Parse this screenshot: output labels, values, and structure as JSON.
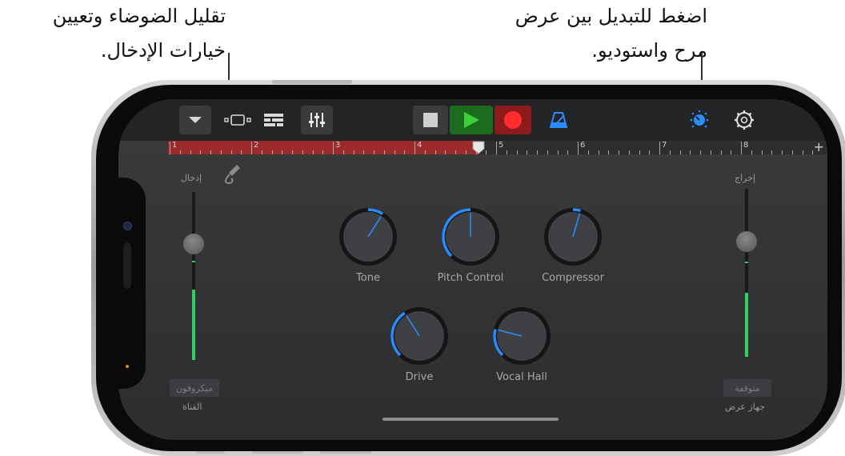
{
  "callouts": {
    "right": {
      "line1": "اضغط للتبديل بين عرض",
      "line2": "مرح واستوديو."
    },
    "left": {
      "line1": "تقليل الضوضاء وتعيين",
      "line2": "خيارات الإدخال."
    }
  },
  "ruler": {
    "bars": [
      "1",
      "2",
      "3",
      "4",
      "5",
      "6",
      "7",
      "8"
    ],
    "add_label": "+"
  },
  "input": {
    "label": "إدخال",
    "channel_button": "ميكروفون",
    "channel_label": "القناة",
    "level": 0.42
  },
  "output": {
    "label": "إخراج",
    "device_button": "متوقفة",
    "device_label": "جهاز عرض",
    "level": 0.38
  },
  "knobs": [
    {
      "name": "Tone",
      "value": 0.62
    },
    {
      "name": "Pitch Control",
      "value": 0.5
    },
    {
      "name": "Compressor",
      "value": 0.56
    },
    {
      "name": "Drive",
      "value": 0.38
    },
    {
      "name": "Vocal Hall",
      "value": 0.22
    }
  ],
  "colors": {
    "accent_blue": "#2a8cff",
    "play_green": "#3ccf3c",
    "record_red": "#ff2d2d",
    "level_green": "#2fd160",
    "ruler_red": "#9d2a2b"
  },
  "icons": {
    "dropdown": "chevron-down-icon",
    "tracks_view": "tracks-view-icon",
    "list_view": "list-view-icon",
    "mixer": "mixer-sliders-icon",
    "stop": "stop-icon",
    "play": "play-icon",
    "record": "record-icon",
    "metronome": "metronome-icon",
    "smart_controls": "smart-controls-knob-icon",
    "settings": "gear-icon",
    "input_settings": "input-jack-icon"
  }
}
